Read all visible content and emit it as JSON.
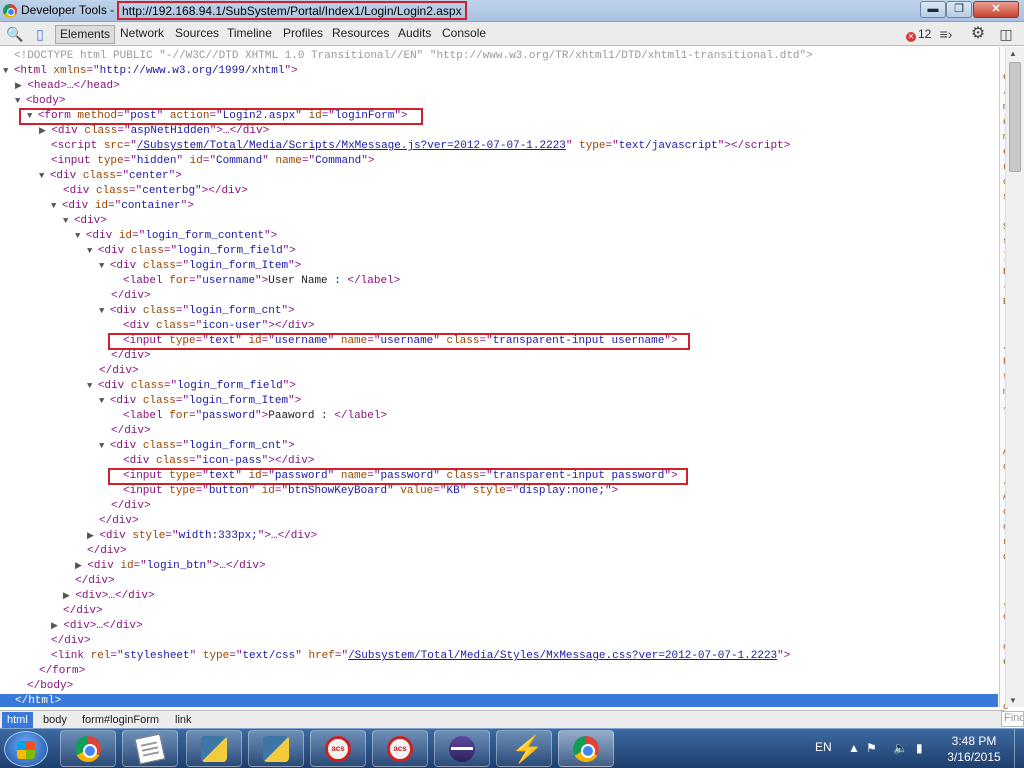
{
  "window": {
    "app_title": "Developer Tools -",
    "url": "http://192.168.94.1/SubSystem/Portal/Index1/Login/Login2.aspx",
    "minimize_glyph": "▬",
    "maximize_glyph": "❐",
    "close_glyph": "✕"
  },
  "toolbar": {
    "tabs": [
      "Elements",
      "Network",
      "Sources",
      "Timeline",
      "Profiles",
      "Resources",
      "Audits",
      "Console"
    ],
    "active_tab": "Elements",
    "error_count": "12",
    "icons": [
      "search-icon",
      "device-icon",
      "execute-icon",
      "settings-icon",
      "dock-icon"
    ]
  },
  "dom": {
    "doctype": "<!DOCTYPE html PUBLIC \"-//W3C//DTD XHTML 1.0 Transitional//EN\" \"http://www.w3.org/TR/xhtml1/DTD/xhtml1-transitional.dtd\">",
    "html_ns": "http://www.w3.org/1999/xhtml",
    "form_method": "post",
    "form_action": "Login2.aspx",
    "form_id": "loginForm",
    "asp_hidden_class": "aspNetHidden",
    "script_src": "/Subsystem/Total/Media/Scripts/MxMessage.js?ver=2012-07-07-1.2223",
    "script_type": "text/javascript",
    "command_type": "hidden",
    "command_id": "Command",
    "command_name": "Command",
    "center_class": "center",
    "centerbg_class": "centerbg",
    "container_id": "container",
    "login_form_content_id": "login_form_content",
    "field_class": "login_form_field",
    "item_class": "login_form_Item",
    "cnt_class": "login_form_cnt",
    "label_username_for": "username",
    "label_username_text": "User Name : ",
    "icon_user_class": "icon-user",
    "input_username_type": "text",
    "input_username_id": "username",
    "input_username_name": "username",
    "input_username_class": "transparent-input username",
    "label_password_for": "password",
    "label_password_text": "Paaword : ",
    "icon_pass_class": "icon-pass",
    "input_password_type": "text",
    "input_password_id": "password",
    "input_password_name": "password",
    "input_password_class": "transparent-input password",
    "kb_type": "button",
    "kb_id": "btnShowKeyBoard",
    "kb_value": "KB",
    "kb_style": "display:none;",
    "width_style": "width:333px;",
    "login_btn_id": "login_btn",
    "link_rel": "stylesheet",
    "link_type": "text/css",
    "link_href": "/Subsystem/Total/Media/Styles/MxMessage.css?ver=2012-07-07-1.2223"
  },
  "breadcrumb": [
    "html",
    "body",
    "form#loginForm",
    "link"
  ],
  "find_placeholder": "Find",
  "side_strip_text": "e\nJ\nm\ne\nm\ne\nr\nc\ns\n.\nS\nt\n]\nE\n{\nE\n\n\nJ\nh\nt\nm\nJ\n\n.\nA\nc\nJ\nA\nc\nc\nr\nd\n\n.\n,\nc\n.\nc\ne\n.\n.\nc\n.\nm\n.\nc\na\np\nJ\n\n.\np\nb",
  "taskbar": {
    "apps": [
      "Google Chrome",
      "Notepad",
      "Python",
      "Python",
      "acs",
      "acs",
      "Eclipse",
      "Eclipse Lightning",
      "Google Chrome"
    ],
    "language": "EN",
    "time": "3:48 PM",
    "date": "3/16/2015"
  },
  "colors": {
    "highlight_box": "#d0202a",
    "selection": "#3879d9",
    "tag": "#881280",
    "attribute": "#994500",
    "value": "#1a1aa6"
  }
}
